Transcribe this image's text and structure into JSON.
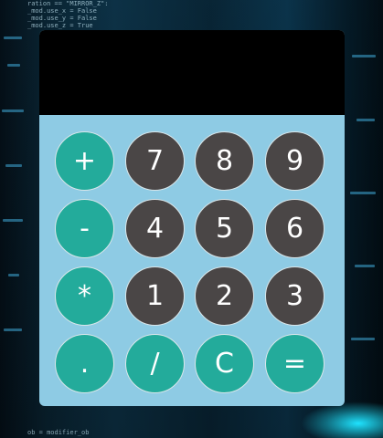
{
  "background": {
    "code_top": "ration == \"MIRROR_Z\":\n_mod.use_x = False\n_mod.use_y = False\n_mod.use_z = True",
    "code_bottom": "ob = modifier_ob"
  },
  "calculator": {
    "display_value": "",
    "colors": {
      "body": "#8ecbe4",
      "display": "#000000",
      "operator_key": "#23ab9b",
      "number_key": "#4a4646"
    },
    "keys": [
      {
        "label": "+",
        "kind": "op"
      },
      {
        "label": "7",
        "kind": "num"
      },
      {
        "label": "8",
        "kind": "num"
      },
      {
        "label": "9",
        "kind": "num"
      },
      {
        "label": "-",
        "kind": "op"
      },
      {
        "label": "4",
        "kind": "num"
      },
      {
        "label": "5",
        "kind": "num"
      },
      {
        "label": "6",
        "kind": "num"
      },
      {
        "label": "*",
        "kind": "op"
      },
      {
        "label": "1",
        "kind": "num"
      },
      {
        "label": "2",
        "kind": "num"
      },
      {
        "label": "3",
        "kind": "num"
      },
      {
        "label": ".",
        "kind": "op"
      },
      {
        "label": "/",
        "kind": "op"
      },
      {
        "label": "C",
        "kind": "op"
      },
      {
        "label": "=",
        "kind": "op"
      }
    ]
  }
}
